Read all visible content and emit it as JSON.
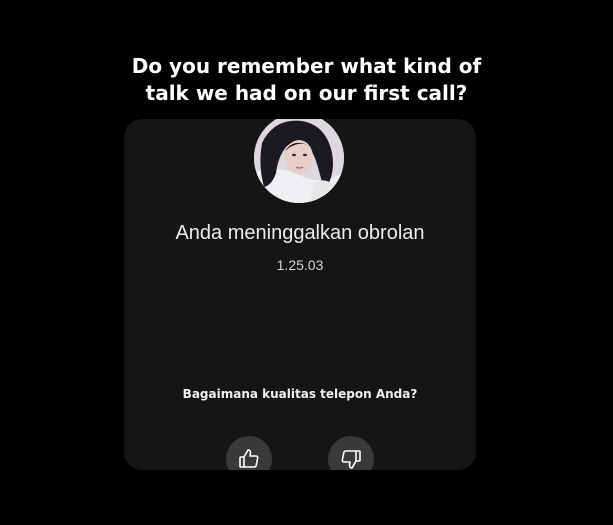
{
  "prompt": {
    "line1": "Do you remember what kind of",
    "line2": "talk we had on our first call?"
  },
  "call": {
    "status": "Anda meninggalkan obrolan",
    "duration": "1.25.03"
  },
  "rating": {
    "question": "Bagaimana kualitas telepon Anda?",
    "buttons": [
      {
        "icon": "thumbs-up-icon"
      },
      {
        "icon": "thumbs-down-icon"
      }
    ]
  },
  "colors": {
    "background": "#000000",
    "card": "#151515",
    "button": "#3a3a3a",
    "text": "#ffffff"
  }
}
